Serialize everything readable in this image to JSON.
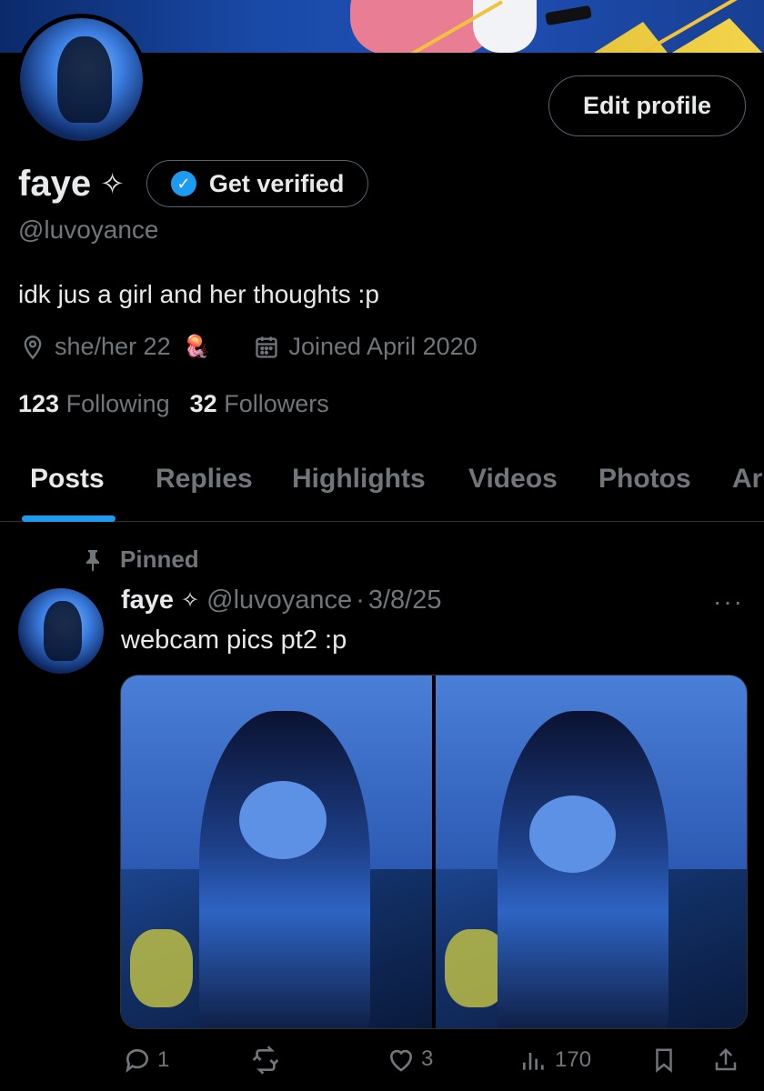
{
  "profile": {
    "display_name": "faye",
    "name_emoji": "✧",
    "handle": "@luvoyance",
    "bio": "idk jus a girl and her thoughts :p",
    "location": "she/her 22",
    "location_emoji": "🪼",
    "joined": "Joined April 2020",
    "following_count": "123",
    "following_label": "Following",
    "followers_count": "32",
    "followers_label": "Followers"
  },
  "buttons": {
    "edit_profile": "Edit profile",
    "get_verified": "Get verified"
  },
  "tabs": [
    {
      "label": "Posts",
      "active": true
    },
    {
      "label": "Replies",
      "active": false
    },
    {
      "label": "Highlights",
      "active": false
    },
    {
      "label": "Videos",
      "active": false
    },
    {
      "label": "Photos",
      "active": false
    },
    {
      "label": "Ar",
      "active": false
    }
  ],
  "post": {
    "pinned_label": "Pinned",
    "author": "faye",
    "author_emoji": "✧",
    "handle": "@luvoyance",
    "separator": "·",
    "date": "3/8/25",
    "more": "···",
    "text": "webcam pics pt2 :p",
    "replies": "1",
    "reposts": "",
    "likes": "3",
    "views": "170"
  },
  "colors": {
    "background": "#000000",
    "accent": "#1d9bf0",
    "text_primary": "#e7e9ea",
    "text_secondary": "#71767b",
    "border": "#2f3336"
  }
}
